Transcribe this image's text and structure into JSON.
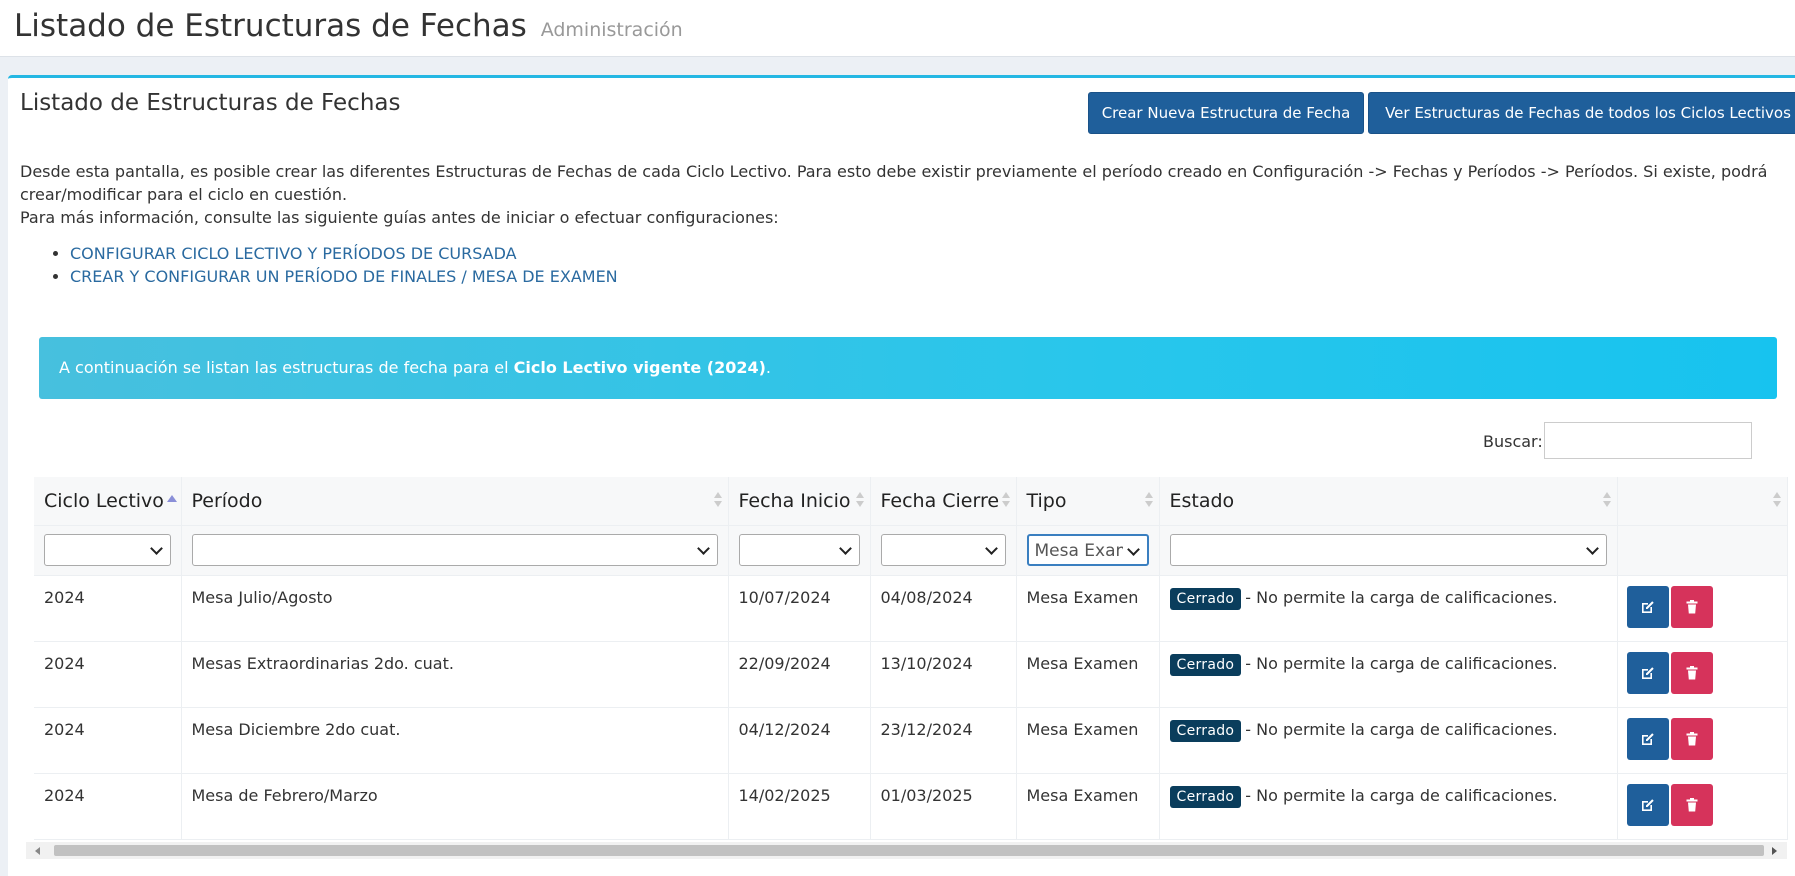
{
  "header": {
    "title": "Listado de Estructuras de Fechas",
    "subtitle": "Administración"
  },
  "box": {
    "title": "Listado de Estructuras de Fechas",
    "buttons": {
      "new": "Crear Nueva Estructura de Fecha",
      "all": "Ver Estructuras de Fechas de todos los Ciclos Lectivos"
    },
    "description_1": "Desde esta pantalla, es posible crear las diferentes Estructuras de Fechas de cada Ciclo Lectivo. Para esto debe existir previamente el período creado en Configuración -> Fechas y Períodos -> Períodos. Si existe, podrá crear/modificar para el ciclo en cuestión.",
    "description_2": "Para más información, consulte las siguiente guías antes de iniciar o efectuar configuraciones:",
    "guides": [
      "CONFIGURAR CICLO LECTIVO Y PERÍODOS DE CURSADA",
      "CREAR Y CONFIGURAR UN PERÍODO DE FINALES / MESA DE EXAMEN"
    ],
    "callout_prefix": "A continuación se listan las estructuras de fecha para el ",
    "callout_bold": "Ciclo Lectivo vigente (2024)",
    "callout_suffix": "."
  },
  "search": {
    "label": "Buscar:",
    "value": ""
  },
  "table": {
    "columns": [
      "Ciclo Lectivo",
      "Período",
      "Fecha Inicio",
      "Fecha Cierre",
      "Tipo",
      "Estado",
      ""
    ],
    "filters": [
      "",
      "",
      "",
      "",
      "Mesa Examen",
      "",
      ""
    ],
    "rows": [
      {
        "ciclo": "2024",
        "periodo": "Mesa Julio/Agosto",
        "inicio": "10/07/2024",
        "cierre": "04/08/2024",
        "tipo": "Mesa Examen",
        "estado_badge": "Cerrado",
        "estado_text": "- No permite la carga de calificaciones."
      },
      {
        "ciclo": "2024",
        "periodo": "Mesas Extraordinarias 2do. cuat.",
        "inicio": "22/09/2024",
        "cierre": "13/10/2024",
        "tipo": "Mesa Examen",
        "estado_badge": "Cerrado",
        "estado_text": "- No permite la carga de calificaciones."
      },
      {
        "ciclo": "2024",
        "periodo": "Mesa Diciembre 2do cuat.",
        "inicio": "04/12/2024",
        "cierre": "23/12/2024",
        "tipo": "Mesa Examen",
        "estado_badge": "Cerrado",
        "estado_text": "- No permite la carga de calificaciones."
      },
      {
        "ciclo": "2024",
        "periodo": "Mesa de Febrero/Marzo",
        "inicio": "14/02/2025",
        "cierre": "01/03/2025",
        "tipo": "Mesa Examen",
        "estado_badge": "Cerrado",
        "estado_text": "- No permite la carga de calificaciones."
      }
    ],
    "row_actions": {
      "edit_icon": "edit-icon",
      "delete_icon": "trash-icon"
    }
  },
  "colors": {
    "primary": "#1f5f9b",
    "danger": "#d6335b",
    "info": "#29c6eb",
    "badge": "#0a3d5c",
    "box_border": "#24b7e3"
  }
}
